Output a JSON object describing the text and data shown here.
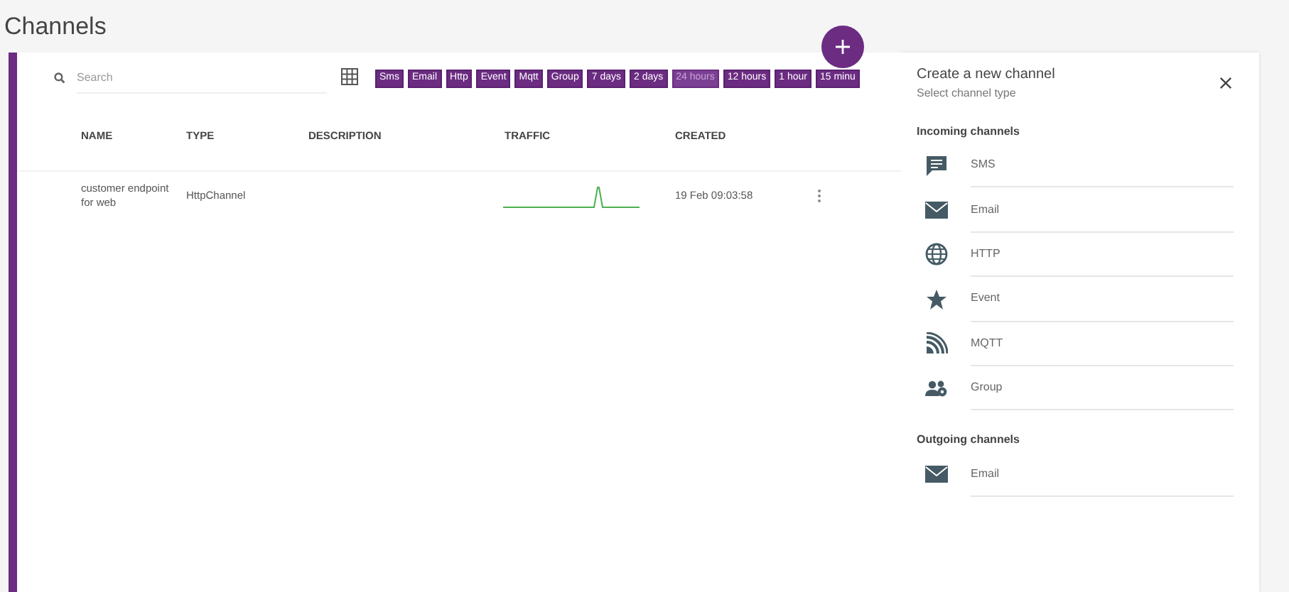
{
  "page_title": "Channels",
  "search": {
    "placeholder": "Search"
  },
  "filters": [
    {
      "label": "Sms",
      "selected": false
    },
    {
      "label": "Email",
      "selected": false
    },
    {
      "label": "Http",
      "selected": false
    },
    {
      "label": "Event",
      "selected": false
    },
    {
      "label": "Mqtt",
      "selected": false
    },
    {
      "label": "Group",
      "selected": false
    },
    {
      "label": "7 days",
      "selected": false
    },
    {
      "label": "2 days",
      "selected": false
    },
    {
      "label": "24 hours",
      "selected": true
    },
    {
      "label": "12 hours",
      "selected": false
    },
    {
      "label": "1 hour",
      "selected": false
    },
    {
      "label": "15 minu",
      "selected": false
    }
  ],
  "table": {
    "columns": [
      "NAME",
      "TYPE",
      "DESCRIPTION",
      "TRAFFIC",
      "CREATED"
    ],
    "rows": [
      {
        "name": "customer endpoint for web",
        "type": "HttpChannel",
        "created": "19 Feb 09:03:58"
      }
    ]
  },
  "panel": {
    "title": "Create a new channel",
    "subtitle": "Select channel type",
    "sections": [
      {
        "heading": "Incoming channels",
        "items": [
          {
            "kind": "sms",
            "label": "SMS"
          },
          {
            "kind": "email",
            "label": "Email"
          },
          {
            "kind": "http",
            "label": "HTTP"
          },
          {
            "kind": "event",
            "label": "Event"
          },
          {
            "kind": "mqtt",
            "label": "MQTT"
          },
          {
            "kind": "group",
            "label": "Group"
          }
        ]
      },
      {
        "heading": "Outgoing channels",
        "items": [
          {
            "kind": "email",
            "label": "Email"
          }
        ]
      }
    ]
  }
}
